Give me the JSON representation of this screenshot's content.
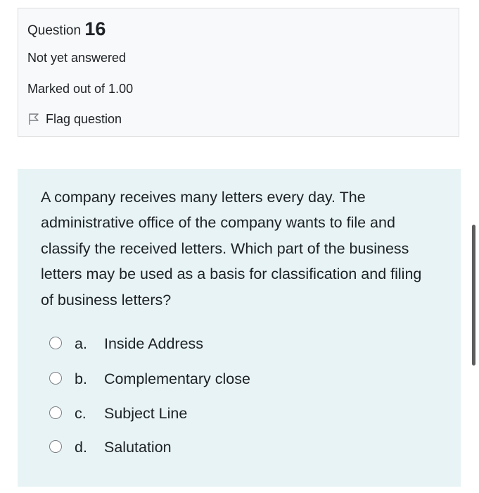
{
  "question": {
    "label": "Question",
    "number": "16",
    "state": "Not yet answered",
    "grade": "Marked out of 1.00",
    "flag_label": "Flag question",
    "text": "A company receives many letters every day. The administrative office of the company wants to file and classify the received letters. Which part of the business letters may be used as a basis for classification and filing of business letters?",
    "answers": [
      {
        "letter": "a.",
        "label": "Inside Address"
      },
      {
        "letter": "b.",
        "label": "Complementary close"
      },
      {
        "letter": "c.",
        "label": "Subject Line"
      },
      {
        "letter": "d.",
        "label": "Salutation"
      }
    ]
  },
  "icons": {
    "flag": "flag-icon",
    "radio": "radio-unchecked-icon"
  },
  "colors": {
    "info_background": "#f8f9fa",
    "info_border": "#d9dbdd",
    "content_background": "#e7f3f5",
    "text": "#1d2125"
  }
}
